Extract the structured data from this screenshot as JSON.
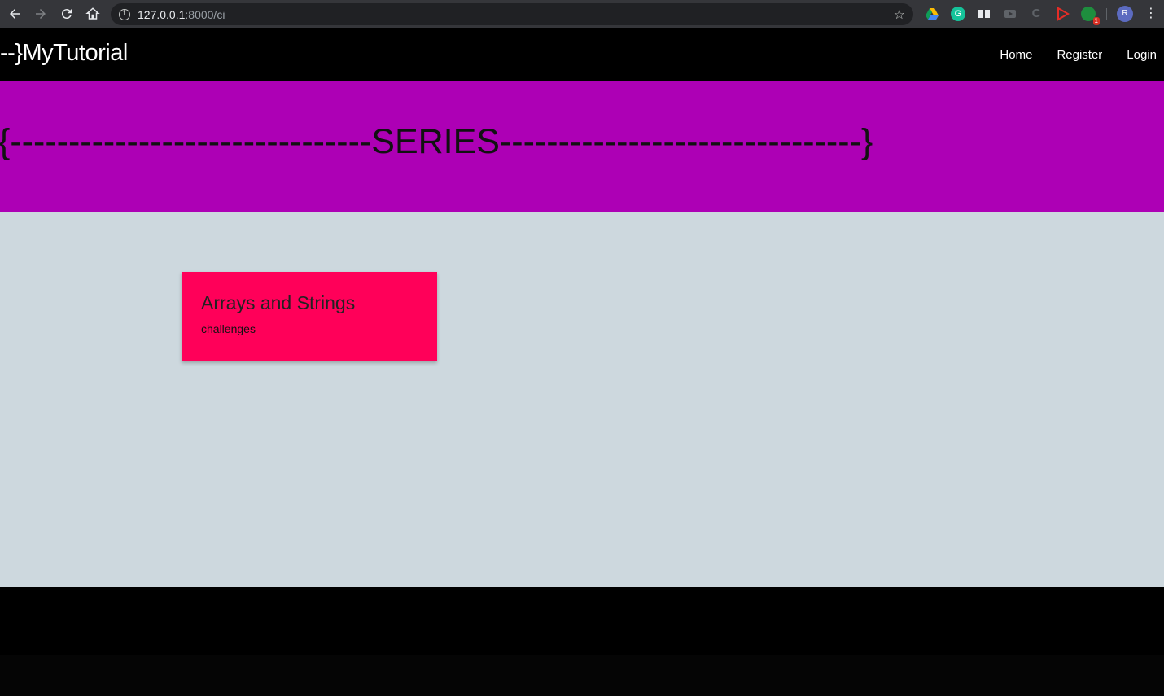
{
  "browser": {
    "url_host": "127.0.0.1",
    "url_path": ":8000/ci",
    "extension_badge": "1",
    "profile_initial": "R"
  },
  "navbar": {
    "brand": "--}MyTutorial",
    "links": [
      "Home",
      "Register",
      "Login"
    ]
  },
  "hero": {
    "title": "{-------------------------------SERIES-------------------------------}"
  },
  "cards": [
    {
      "title": "Arrays and Strings",
      "subtitle": "challenges"
    }
  ],
  "colors": {
    "hero_bg": "#ad00b5",
    "card_bg": "#ff0059",
    "content_bg": "#cdd8de",
    "navbar_bg": "#000000"
  }
}
